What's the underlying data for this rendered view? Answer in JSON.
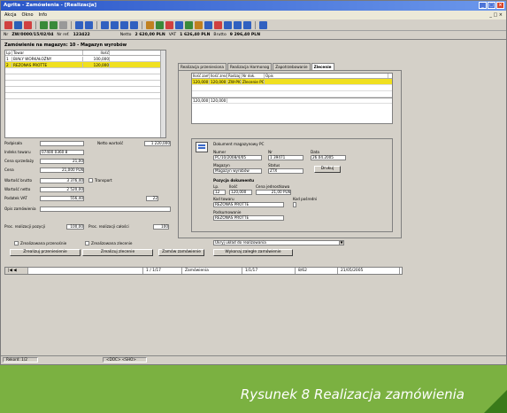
{
  "window": {
    "title": "Agrita - Zamówienia - [Realizacja]",
    "controls": [
      "_",
      "□",
      "×"
    ]
  },
  "menu": {
    "items": [
      "Akcja",
      "Okno",
      "Info"
    ],
    "right": "_ □ ×"
  },
  "infobar": {
    "nr_label": "Nr",
    "nr_value": "ZW/0000/15/02/04",
    "ref_label": "Nr ref.",
    "ref_value": "123422",
    "netto_label": "Netto",
    "netto_value": "2 620,00 PLN",
    "vat_label": "VAT",
    "vat_value": "1 626,40 PLN",
    "brutto_label": "Brutto",
    "brutto_value": "9 296,40 PLN"
  },
  "left": {
    "header": "Zamówienie na magazyn: 10 - Magazyn wyrobów",
    "grid_headers": [
      "Lp",
      "Towar",
      "Ilość"
    ],
    "rows": [
      {
        "lp": "1",
        "name": "BIAŁY WORKAŁOŻNY",
        "qty": "100,000"
      },
      {
        "lp": "2",
        "name": "REZONAS PROTTE",
        "qty": "120,000"
      }
    ]
  },
  "fields": {
    "podpis_label": "Podpisała",
    "netto_wartosc_label": "Netto wartość",
    "netto_wartosc": "1 220,000",
    "indeks_label": "Indeks towaru",
    "indeks": "07400 0360 8",
    "cena_zl_label": "Cena sprzedaży",
    "cena_zl": "21,00",
    "cena_ub_label": "Cena",
    "cena_ub": "21,000 PLN",
    "wart_brutto_label": "Wartość brutto",
    "wart_brutto": "3 376,40",
    "transport_label": "Transport",
    "wart_netto_label": "Wartość netto",
    "wart_netto": "2 520,00",
    "podatek_label": "Podatek VAT",
    "podatek": "556,40",
    "vat": "22",
    "opis_label": "Opis zamówienia",
    "proc_label": "Proc. realizacji pozycji",
    "proc_value": "100,00",
    "proc2_label": "Proc. realizacji całości",
    "proc2_value": "100"
  },
  "tabs": [
    "Realizacja przeniesiona",
    "Realizacja Harmonog",
    "Zapotrzebowanie",
    "Zlecenie"
  ],
  "rgrid": {
    "headers": [
      "Ilość zamówiona",
      "Ilość zrealizowana",
      "Rodzaj dok.",
      "Nr dok.",
      "Opis"
    ],
    "row": [
      "120,000",
      "120,000",
      "ZW-PIC",
      "Zlecenie PC",
      ""
    ],
    "sum": [
      "120,000",
      "120,000"
    ]
  },
  "doc": {
    "title": "Dokument magazynowy PC",
    "nr_label": "Numer",
    "nr": "PC/10/2008/4/05",
    "nr2_label": "Nr",
    "nr2": "1 39471",
    "data_label": "Data",
    "data": "26.04.2005",
    "mag_label": "Magazyn",
    "mag": "Magazyn wyrobów",
    "status_label": "Status",
    "status": "ZTX",
    "button": "Drukuj",
    "poz_label": "Pozycja dokumentu",
    "lp_label": "Lp.",
    "lp": "12",
    "ilosc_label": "Ilość",
    "ilosc": "120,000",
    "cena_label": "Cena jednostkowa",
    "cena": "21,00 PLN",
    "kod_label": "Kod towaru",
    "kod": "REZONAS PROTTE",
    "pods_label": "Podsumowanie",
    "pods": "REZONAS PROTTE",
    "kod2_label": "Kod pośredni"
  },
  "checks": {
    "c1": "Zrealizowana przenośnie",
    "c2": "Zrealizowana zlecenie"
  },
  "buttons": {
    "b1": "Zrealizuj przeniesienie",
    "b2": "Zrealizuj zlecenie",
    "b3": "Zamów zamówienie",
    "b4": "Wykonaj zaległe zamówienie",
    "dropdown": "Ukryj układ do realizowania"
  },
  "navbar": {
    "cells": [
      "|◀ ◀",
      "",
      "1 / 1/17",
      "Zamówienia",
      "1/1/17",
      "8/62",
      "21/05/2005"
    ]
  },
  "status": {
    "cells": [
      "Rekord: 1/2",
      "<DOC> <SHO>"
    ]
  },
  "caption": "Rysunek 8 Realizacja zamówienia"
}
